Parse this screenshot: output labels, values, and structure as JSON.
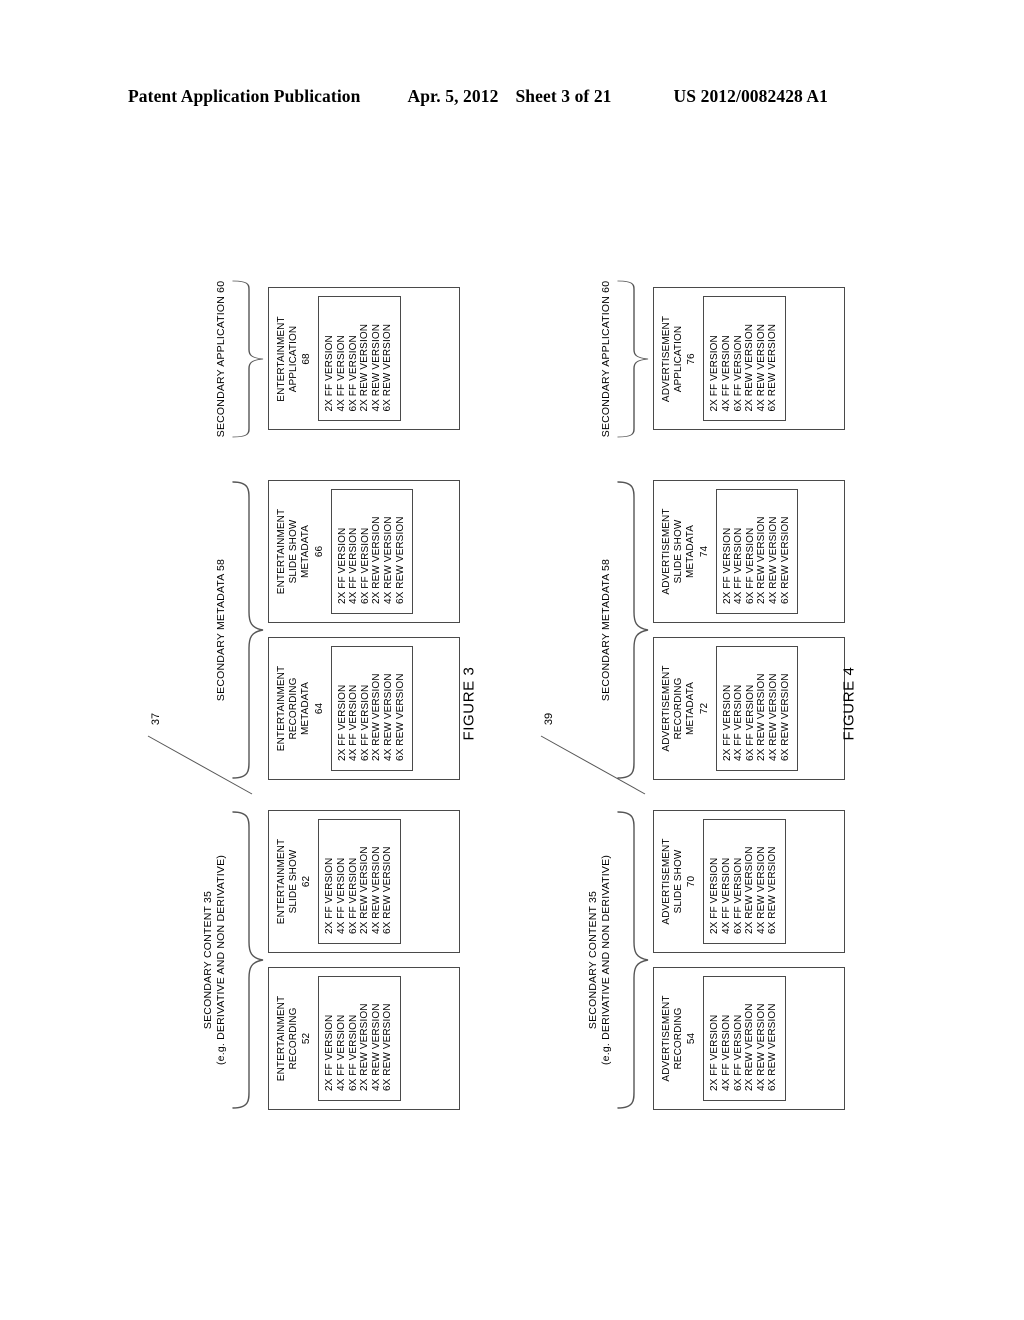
{
  "header": {
    "publication": "Patent Application Publication",
    "date": "Apr. 5, 2012",
    "sheet": "Sheet 3 of 21",
    "document_number": "US 2012/0082428 A1"
  },
  "versions": [
    "2X FF VERSION",
    "4X FF VERSION",
    "6X FF VERSION",
    "2X REW VERSION",
    "4X REW VERSION",
    "6X REW VERSION"
  ],
  "figures": [
    {
      "id": "figure3",
      "caption": "FIGURE 3",
      "ref_tag": "37",
      "groups": [
        {
          "label": "SECONDARY CONTENT 35\n(e.g. DERIVATIVE AND NON DERIVATIVE)",
          "nodes": [
            {
              "title": "ENTERTAINMENT\nRECORDING",
              "ref": "52"
            },
            {
              "title": "ENTERTAINMENT\nSLIDE SHOW",
              "ref": "62"
            }
          ]
        },
        {
          "label": "SECONDARY METADATA 58",
          "nodes": [
            {
              "title": "ENTERTAINMENT\nRECORDING\nMETADATA",
              "ref": "64"
            },
            {
              "title": "ENTERTAINMENT\nSLIDE SHOW\nMETADATA",
              "ref": "66"
            }
          ]
        },
        {
          "label": "SECONDARY APPLICATION 60",
          "nodes": [
            {
              "title": "ENTERTAINMENT\nAPPLICATION",
              "ref": "68"
            }
          ]
        }
      ]
    },
    {
      "id": "figure4",
      "caption": "FIGURE 4",
      "ref_tag": "39",
      "groups": [
        {
          "label": "SECONDARY CONTENT 35\n(e.g. DERIVATIVE AND NON DERIVATIVE)",
          "nodes": [
            {
              "title": "ADVERTISEMENT\nRECORDING",
              "ref": "54"
            },
            {
              "title": "ADVERTISEMENT\nSLIDE SHOW",
              "ref": "70"
            }
          ]
        },
        {
          "label": "SECONDARY METADATA 58",
          "nodes": [
            {
              "title": "ADVERTISEMENT\nRECORDING\nMETADATA",
              "ref": "72"
            },
            {
              "title": "ADVERTISEMENT\nSLIDE SHOW\nMETADATA",
              "ref": "74"
            }
          ]
        },
        {
          "label": "SECONDARY APPLICATION 60",
          "nodes": [
            {
              "title": "ADVERTISEMENT\nAPPLICATION",
              "ref": "76"
            }
          ]
        }
      ]
    }
  ]
}
